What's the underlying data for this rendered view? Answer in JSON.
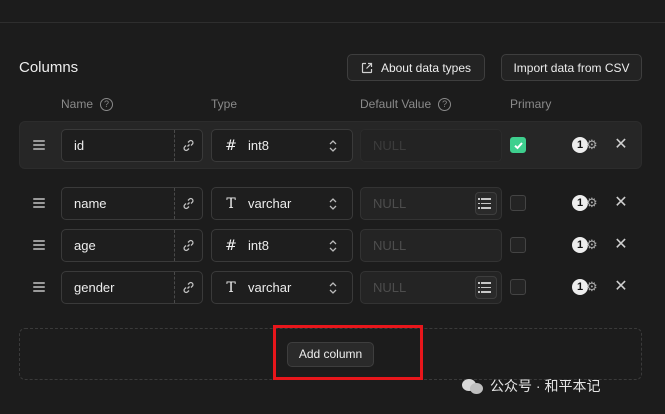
{
  "section": {
    "title": "Columns"
  },
  "toolbar": {
    "about_label": "About data types",
    "import_label": "Import data from CSV"
  },
  "headers": {
    "name": "Name",
    "type": "Type",
    "default_value": "Default Value",
    "primary": "Primary"
  },
  "columns": [
    {
      "name": "id",
      "type_icon": "#",
      "type": "int8",
      "default_placeholder": "NULL",
      "primary": true,
      "badge": "1"
    },
    {
      "name": "name",
      "type_icon": "T",
      "type": "varchar",
      "default_placeholder": "NULL",
      "primary": false,
      "badge": "1"
    },
    {
      "name": "age",
      "type_icon": "#",
      "type": "int8",
      "default_placeholder": "NULL",
      "primary": false,
      "badge": "1"
    },
    {
      "name": "gender",
      "type_icon": "T",
      "type": "varchar",
      "default_placeholder": "NULL",
      "primary": false,
      "badge": "1"
    }
  ],
  "add_column_label": "Add column",
  "watermark": "公众号 · 和平本记",
  "colors": {
    "background": "#1c1c1c",
    "accent": "#3ecf8e",
    "highlight": "#e8161b"
  }
}
